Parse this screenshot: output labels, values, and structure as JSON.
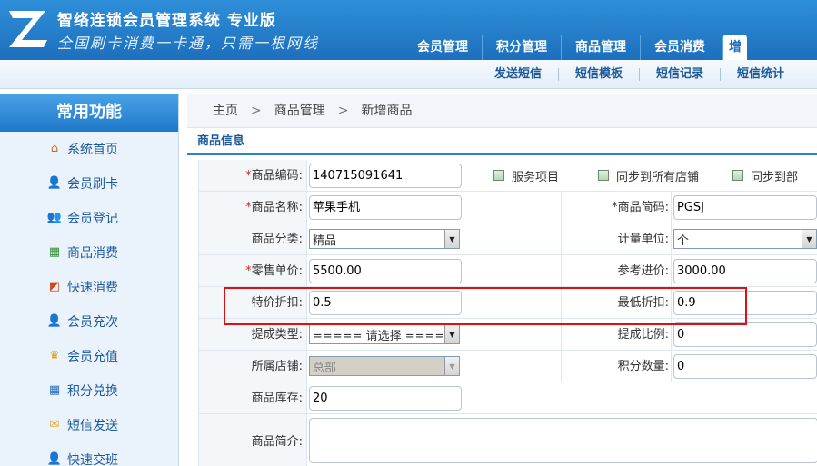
{
  "header": {
    "title": "智络连锁会员管理系统 专业版",
    "slogan": "全国刷卡消费一卡通，只需一根网线",
    "tabs": [
      "会员管理",
      "积分管理",
      "商品管理",
      "会员消费",
      "增"
    ]
  },
  "subnav": [
    "发送短信",
    "短信模板",
    "短信记录",
    "短信统计"
  ],
  "sidebar": {
    "title": "常用功能",
    "items": [
      {
        "label": "系统首页",
        "icon": "home-icon"
      },
      {
        "label": "会员刷卡",
        "icon": "member-card-icon"
      },
      {
        "label": "会员登记",
        "icon": "member-register-icon"
      },
      {
        "label": "商品消费",
        "icon": "cart-icon"
      },
      {
        "label": "快速消费",
        "icon": "chart-icon"
      },
      {
        "label": "会员充次",
        "icon": "member-recharge-icon"
      },
      {
        "label": "会员充值",
        "icon": "crown-icon"
      },
      {
        "label": "积分兑换",
        "icon": "grid-icon"
      },
      {
        "label": "短信发送",
        "icon": "envelope-icon"
      },
      {
        "label": "快速交班",
        "icon": "user-shift-icon"
      }
    ]
  },
  "breadcrumb": [
    "主页",
    "商品管理",
    "新增商品"
  ],
  "section_title": "商品信息",
  "form": {
    "code_label": "商品编码:",
    "code_value": "140715091641",
    "checkboxes": [
      "服务项目",
      "同步到所有店铺",
      "同步到部"
    ],
    "name_label": "商品名称:",
    "name_value": "苹果手机",
    "abbr_label": "商品简码:",
    "abbr_value": "PGSJ",
    "category_label": "商品分类:",
    "category_value": "精品",
    "unit_label": "计量单位:",
    "unit_value": "个",
    "retail_label": "零售单价:",
    "retail_value": "5500.00",
    "ref_price_label": "参考进价:",
    "ref_price_value": "3000.00",
    "special_discount_label": "特价折扣:",
    "special_discount_value": "0.5",
    "min_discount_label": "最低折扣:",
    "min_discount_value": "0.9",
    "commission_type_label": "提成类型:",
    "commission_type_value": "===== 请选择 =====",
    "commission_ratio_label": "提成比例:",
    "commission_ratio_value": "0",
    "store_label": "所属店铺:",
    "store_value": "总部",
    "points_label": "积分数量:",
    "points_value": "0",
    "stock_label": "商品库存:",
    "stock_value": "20",
    "intro_label": "商品简介:"
  },
  "colors": {
    "header_blue": "#1d6fbd",
    "highlight_red": "#e01010",
    "required_red": "#e02020"
  }
}
